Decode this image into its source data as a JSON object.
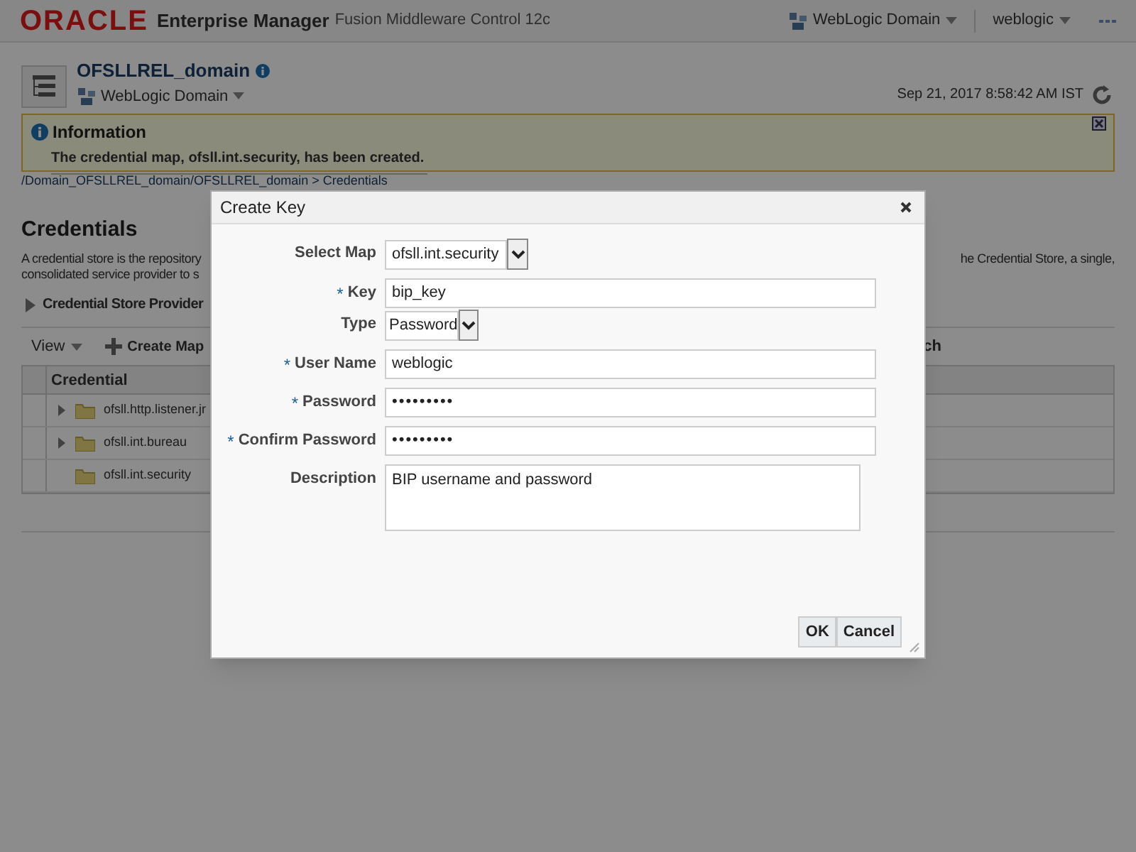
{
  "header": {
    "logo": "ORACLE",
    "product": "Enterprise Manager",
    "subtitle": "Fusion Middleware Control 12c",
    "target_menu": "WebLogic Domain",
    "user_menu": "weblogic"
  },
  "target": {
    "name": "OFSLLREL_domain",
    "type": "WebLogic Domain",
    "timestamp": "Sep 21, 2017 8:58:42 AM IST"
  },
  "info": {
    "title": "Information",
    "message": "The credential map, ofsll.int.security, has been created."
  },
  "breadcrumb": "/Domain_OFSLLREL_domain/OFSLLREL_domain > Credentials",
  "page": {
    "title": "Credentials",
    "description_left": [
      "A credential store is the repository",
      "consolidated service provider to s"
    ],
    "description_right": "he Credential Store, a single,",
    "section": "Credential Store Provider",
    "expanded": false
  },
  "toolbar": {
    "view": "View",
    "create_map": "Create Map",
    "right_fragment": "ch"
  },
  "table": {
    "columns": [
      "Credential"
    ],
    "rows": [
      {
        "name": "ofsll.http.listener.jr",
        "has_children": true
      },
      {
        "name": "ofsll.int.bureau",
        "has_children": true
      },
      {
        "name": "ofsll.int.security",
        "has_children": false
      }
    ]
  },
  "dialog": {
    "title": "Create Key",
    "fields": [
      {
        "kind": "select",
        "label": "Select Map",
        "value": "ofsll.int.security"
      },
      {
        "kind": "text",
        "marker": "*",
        "label": "Key",
        "value": "bip_key"
      },
      {
        "kind": "select-small",
        "label": "Type",
        "value": "Password"
      },
      {
        "kind": "text",
        "marker": "*",
        "label": "User Name",
        "value": "weblogic"
      },
      {
        "kind": "password",
        "marker": "*",
        "label": "Password",
        "value": "•••••••••"
      },
      {
        "kind": "password",
        "marker": "*",
        "label": "Confirm Password",
        "value": "•••••••••"
      },
      {
        "kind": "textarea",
        "label": "Description",
        "value": "BIP username and password"
      }
    ],
    "buttons": [
      "OK",
      "Cancel"
    ]
  }
}
